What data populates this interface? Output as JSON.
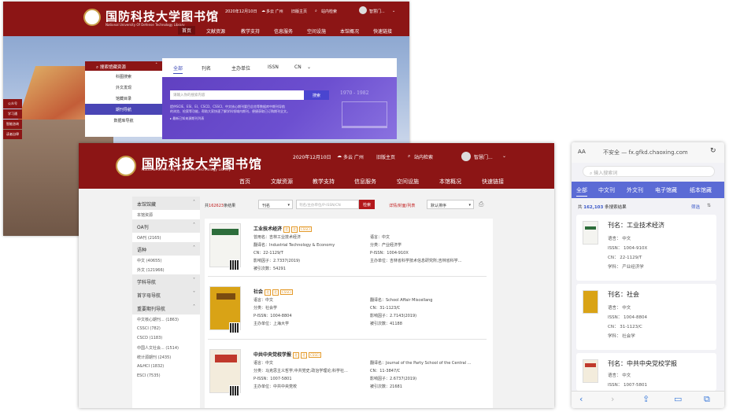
{
  "colors": {
    "brand": "#8c1515",
    "accent": "#4a45b5",
    "link": "#3b58c8",
    "highlight": "#c21d1d"
  },
  "back": {
    "logo_title": "国防科技大学图书馆",
    "logo_sub": "National University Of Defense Technology Library",
    "date": "2020年12月10日",
    "weather": "多云 广州",
    "old": "旧版主页",
    "search": "站内检索",
    "user": "智慧门...",
    "nav": [
      "首页",
      "文献资源",
      "教学支持",
      "信息服务",
      "空间设施",
      "本馆概况",
      "快速链接"
    ],
    "cat_header": "搜索馆藏资源",
    "cat_items": [
      "科图搜索",
      "外文发现",
      "馆藏目录",
      "期刊导航",
      "数据库导航"
    ],
    "tabs": [
      "全部",
      "刊名",
      "主办单位",
      "ISSN",
      "CN"
    ],
    "search_placeholder": "请输入你的搜索内容",
    "search_button": "搜索",
    "desc": "提供SCIE、ESI、EI、CSCD、CSSCI、中文核心期刊要目总览等数据库中期刊导航",
    "desc2": "的浏览、检索等功能，帮助大家快速了解学科领域内期刊，便捷获取已订购期刊全文。",
    "desc_link": "最新已知来源期刊列表",
    "year": "1970 - 1982",
    "side_items": [
      "公众号",
      "学习通",
      "智能咨询",
      "读者自律"
    ]
  },
  "main": {
    "logo_title": "国防科技大学图书馆",
    "logo_sub": "National University Of Defense Technology Library",
    "date": "2020年12月10日",
    "weather": "多云 广州",
    "old": "旧版主页",
    "search": "站内检索",
    "user": "智慧门...",
    "nav": [
      "首页",
      "文献资源",
      "教学支持",
      "信息服务",
      "空间设施",
      "本馆概况",
      "快速链接"
    ],
    "left": [
      {
        "h": "本馆馆藏",
        "items": [
          "本馆资源"
        ]
      },
      {
        "h": "OA刊",
        "items": [
          "OA刊 (2165)"
        ]
      },
      {
        "h": "语种",
        "items": [
          "中文 (40655)",
          "外文 (121966)"
        ]
      },
      {
        "h": "学科导航",
        "items": []
      },
      {
        "h": "首字母导航",
        "items": []
      },
      {
        "h": "重要期刊导航",
        "items": [
          "中文核心期刊... (1863)",
          "CSSCI (782)",
          "CSCD (1183)",
          "中国人文社会... (1514)",
          "统计源期刊 (2435)",
          "A&HCI (1832)",
          "ESCI (7535)"
        ]
      }
    ],
    "count_pre": "共",
    "count": "162623",
    "count_post": "条结果",
    "field": "刊名",
    "field_placeholder": "刊名/主办单位/P-ISSN/CN",
    "search_button": "检索",
    "view_label": "详情/封面/列表",
    "sort": "默认排序",
    "items": [
      {
        "title": "工业技术经济",
        "tags": [
          "北",
          "北",
          "CSSCI"
        ],
        "l": [
          "曾用名：吉林工业技术经济",
          "翻译名：Industrial Technology & Economy",
          "CN：22-1129/T",
          "影响因子：2.7337(2019)",
          "被引次数：54291"
        ],
        "r": [
          "语言：中文",
          "分类：产业经济学",
          "P-ISSN：1004-910X",
          "主办单位：吉林省科学技术信息研究所;吉林省科学..."
        ]
      },
      {
        "title": "社会",
        "tags": [
          "北",
          "北",
          "CSSCI"
        ],
        "l": [
          "语言：中文",
          "分类：社会学",
          "P-ISSN：1004-8804",
          "主办单位：上海大学"
        ],
        "r": [
          "翻译名：School Affair Miscellang",
          "CN：31-1123/C",
          "影响因子：2.7143(2019)",
          "被引次数：41188"
        ]
      },
      {
        "title": "中共中央党校学报",
        "tags": [
          "北",
          "北",
          "CSSCI"
        ],
        "l": [
          "语言：中文",
          "分类：马克思主义哲学;中共党史;政治学理论;科学社...",
          "P-ISSN：1007-5801",
          "主办单位：中共中央党校"
        ],
        "r": [
          "翻译名：Journal of the Party School of the Central ...",
          "CN：11-3847/C",
          "影响因子：2.6737(2019)",
          "被引次数：21681"
        ]
      }
    ]
  },
  "mobile": {
    "aa": "AA",
    "url": "不安全 — fx.gfkd.chaoxing.com",
    "reload": "↻",
    "search_placeholder": "输入搜索词",
    "tabs": [
      "全部",
      "中文刊",
      "外文刊",
      "电子馆藏",
      "纸本馆藏"
    ],
    "count_pre": "共",
    "count": "162,103",
    "count_post": "条搜索结果",
    "filter": "筛选",
    "cards": [
      {
        "title": "刊名：工业技术经济",
        "f": [
          "语言：  中文",
          "ISSN：  1004-910X",
          "CN：  22-1129/T",
          "学科：  产业经济学"
        ]
      },
      {
        "title": "刊名：社会",
        "f": [
          "语言：  中文",
          "ISSN：  1004-8804",
          "CN：  31-1123/C",
          "学科：  社会学"
        ]
      },
      {
        "title": "刊名：中共中央党校学报",
        "f": [
          "语言：  中文",
          "ISSN：  1007-5801"
        ]
      }
    ],
    "bottom": [
      "‹",
      "›",
      "⇪",
      "▭",
      "⧉"
    ]
  }
}
